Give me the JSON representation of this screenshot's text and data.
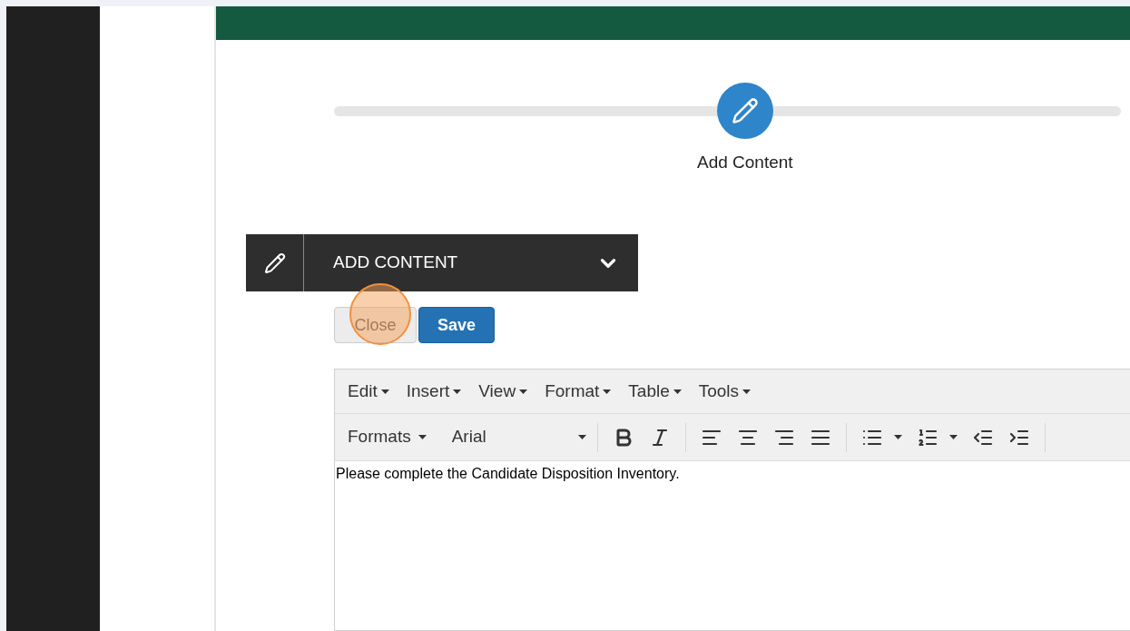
{
  "stepper": {
    "steps": [
      {
        "label": "Add Content",
        "selected": true
      }
    ]
  },
  "panel": {
    "title": "ADD CONTENT",
    "expanded": true
  },
  "buttons": [
    {
      "label": "Close",
      "kind": "secondary"
    },
    {
      "label": "Save",
      "kind": "primary"
    }
  ],
  "editor": {
    "menus": [
      "Edit",
      "Insert",
      "View",
      "Format",
      "Table",
      "Tools"
    ],
    "formats_label": "Formats",
    "font": "Arial",
    "tools": [
      {
        "kind": "bold"
      },
      {
        "kind": "italic"
      },
      {
        "kind": "sep"
      },
      {
        "kind": "align-left"
      },
      {
        "kind": "align-center"
      },
      {
        "kind": "align-right"
      },
      {
        "kind": "align-justify"
      },
      {
        "kind": "sep"
      },
      {
        "kind": "bullet-list"
      },
      {
        "kind": "numbered-list"
      },
      {
        "kind": "outdent"
      },
      {
        "kind": "indent"
      },
      {
        "kind": "sep"
      }
    ],
    "content": "Please complete the Candidate Disposition Inventory."
  }
}
